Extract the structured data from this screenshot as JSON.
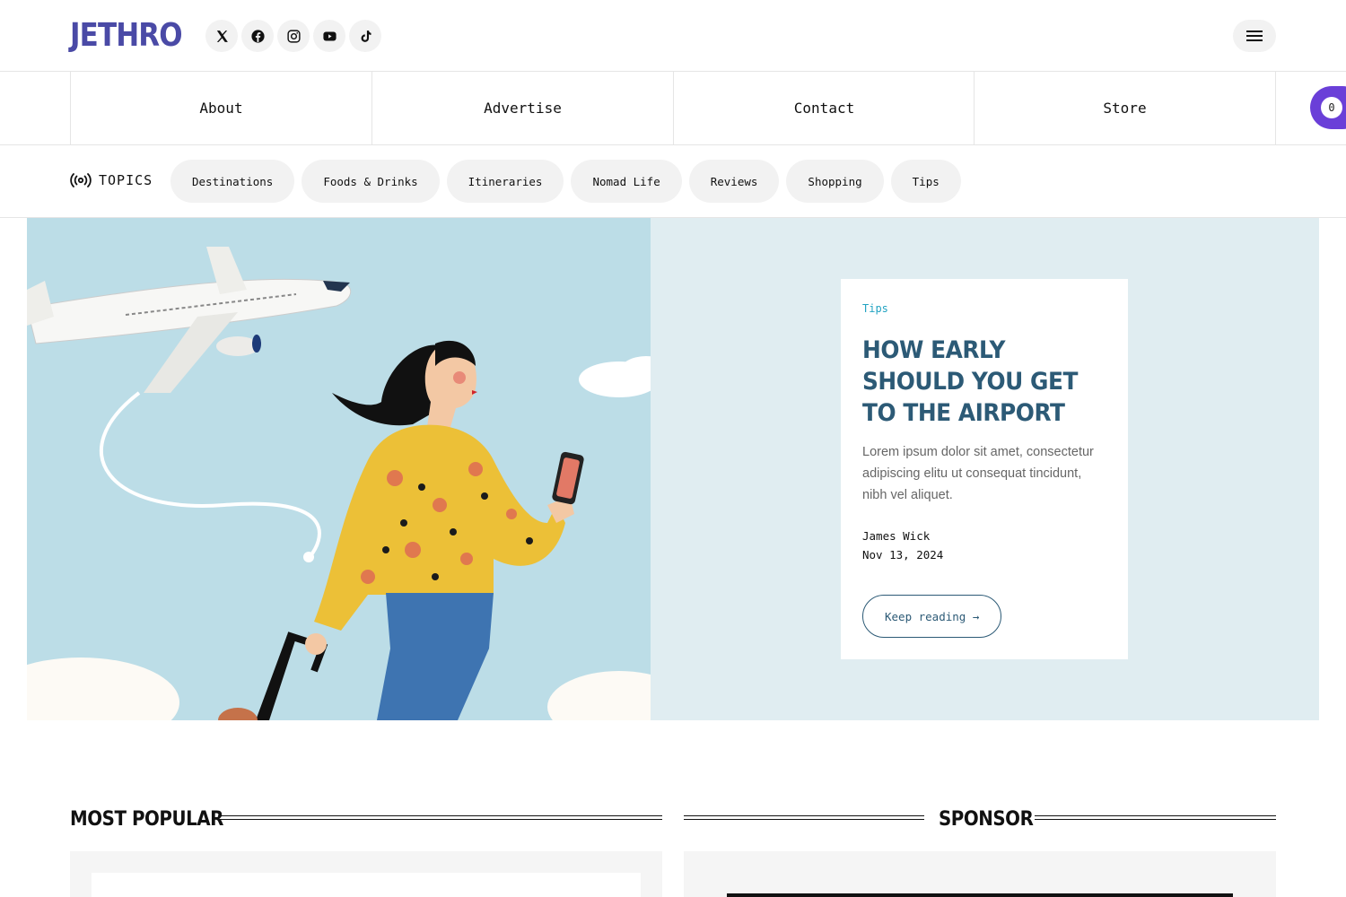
{
  "header": {
    "logo": "JETHRO",
    "socials": [
      {
        "icon": "x-icon"
      },
      {
        "icon": "facebook-icon"
      },
      {
        "icon": "instagram-icon"
      },
      {
        "icon": "youtube-icon"
      },
      {
        "icon": "tiktok-icon"
      }
    ],
    "menu_icon": "hamburger-menu-icon"
  },
  "nav": {
    "items": [
      "About",
      "Advertise",
      "Contact",
      "Store"
    ],
    "cart_count": "0"
  },
  "topics": {
    "label": "TOPICS",
    "icon": "broadcast-icon",
    "chips": [
      "Destinations",
      "Foods & Drinks",
      "Itineraries",
      "Nomad Life",
      "Reviews",
      "Shopping",
      "Tips"
    ]
  },
  "hero": {
    "category": "Tips",
    "title": "How early should you get to the airport",
    "excerpt": "Lorem ipsum dolor sit amet, consectetur adipiscing elitu ut consequat tincidunt, nibh vel aliquet.",
    "author": "James Wick",
    "date": "Nov 13, 2024",
    "button": "Keep reading →"
  },
  "sections": {
    "most_popular": "MOST POPULAR",
    "sponsor": "SPONSOR"
  },
  "colors": {
    "brand": "#4a4aa6",
    "cart": "#6a3fd8",
    "title": "#2c5a76",
    "category": "#22a3c2",
    "hero_bg": "#e0edf1"
  }
}
